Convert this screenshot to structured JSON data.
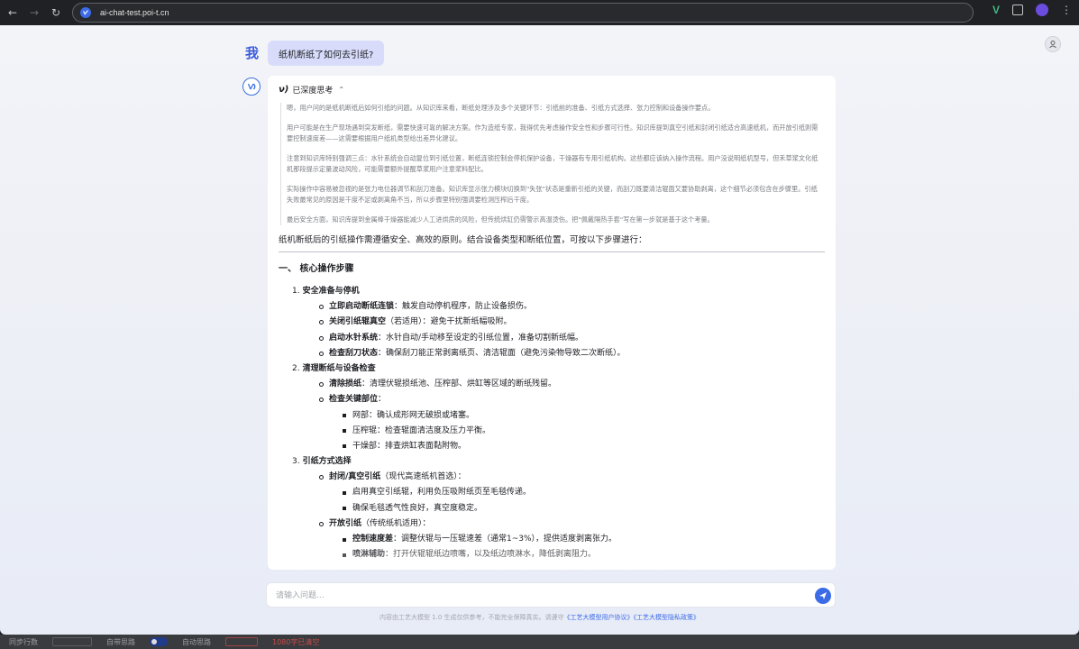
{
  "browser": {
    "url": "ai-chat-test.poi-t.cn",
    "ext_label": "V"
  },
  "chat": {
    "user_label": "我",
    "user_question": "纸机断纸了如何去引纸?",
    "thinking_title": "已深度思考",
    "thinking_logo": "ν)",
    "thinking_paragraphs": [
      "嗯，用户问的是纸机断纸后如何引纸的问题。从知识库来看，断纸处理涉及多个关键环节：引纸前的准备、引纸方式选择、张力控制和设备操作要点。",
      "用户可能是在生产现场遇到突发断纸，需要快速可靠的解决方案。作为造纸专家，我得优先考虑操作安全性和步骤可行性。知识库提到真空引纸和封闭引纸适合高速纸机，而开放引纸则需要控制速度差——这需要根据用户纸机类型给出差异化建议。",
      "注意到知识库特别强调三点：水针系统会自动复位到引纸位置，断纸连锁控制会停机保护设备，干燥器有专用引纸机构。这些都应该纳入操作流程。用户没说明纸机型号，但禾草浆文化纸机那段提示定量波动风险，可能需要额外提醒草浆用户注意浆料配比。",
      "实际操作中容易被忽视的是张力电位器调节和刮刀准备。知识库显示张力模块切换到\"失张\"状态是重新引纸的关键，而刮刀既要清洁辊面又要协助剥离，这个细节必须包含在步骤里。引纸失败最常见的原因是干度不足或剥离角不当，所以步骤里特别强调要检测压榨后干度。",
      "最后安全方面，知识库提到金属棒干燥器能减少人工进烘房的风险，但传统烘缸仍需警示高温烫伤。把\"佩戴隔热手套\"写在第一步就是基于这个考量。"
    ],
    "answer_intro": "纸机断纸后的引纸操作需遵循安全、高效的原则。结合设备类型和断纸位置，可按以下步骤进行：",
    "section_title": "一、 核心操作步骤",
    "steps": [
      {
        "num": "1.",
        "title": "安全准备与停机",
        "items": [
          {
            "key": "立即启动断纸连锁",
            "text": "：触发自动停机程序，防止设备损伤。"
          },
          {
            "key": "关闭引纸辊真空",
            "text": "（若适用）：避免干扰新纸幅吸附。"
          },
          {
            "key": "启动水针系统",
            "text": "：水针自动/手动移至设定的引纸位置，准备切割新纸幅。"
          },
          {
            "key": "检查刮刀状态",
            "text": "：确保刮刀能正常剥离纸页、清洁辊面（避免污染物导致二次断纸）。"
          }
        ]
      },
      {
        "num": "2.",
        "title": "清理断纸与设备检查",
        "items": [
          {
            "key": "清除损纸",
            "text": "：清理伏辊损纸池、压榨部、烘缸等区域的断纸残留。"
          },
          {
            "key": "检查关键部位",
            "text": "："
          }
        ],
        "subitems": [
          "网部：确认成形网无破损或堵塞。",
          "压榨辊：检查辊面清洁度及压力平衡。",
          "干燥部：排查烘缸表面黏附物。"
        ]
      },
      {
        "num": "3.",
        "title": "引纸方式选择",
        "closed": {
          "key": "封闭/真空引纸",
          "text": "（现代高速纸机首选）："
        },
        "closed_sub": [
          "启用真空引纸辊，利用负压吸附纸页至毛毯传递。",
          "确保毛毯透气性良好，真空度稳定。"
        ],
        "open": {
          "key": "开放引纸",
          "text": "（传统纸机适用）："
        },
        "open_sub": [
          {
            "key": "控制速度差",
            "text": "：调整伏辊与一压辊速差（通常1~3%），提供适度剥离张力。"
          },
          {
            "key": "喷淋辅助",
            "text": "：打开伏辊辊纸边喷嘴，以及纸边喷淋水，降低剥离阻力。"
          }
        ]
      }
    ]
  },
  "input": {
    "placeholder": "请输入问题..."
  },
  "disclaimer": {
    "text": "内容由工艺大模型 1.0 生成仅供参考，不能完全保障真实。请遵守",
    "link1": "《工艺大模型用户协议》",
    "link2": "《工艺大模型隐私政策》"
  },
  "bottom_strip": {
    "left_text": "同步行数",
    "toggle_text": "自带思路",
    "toggle2_text": "自动思路",
    "red_text": "1080字已清空"
  }
}
